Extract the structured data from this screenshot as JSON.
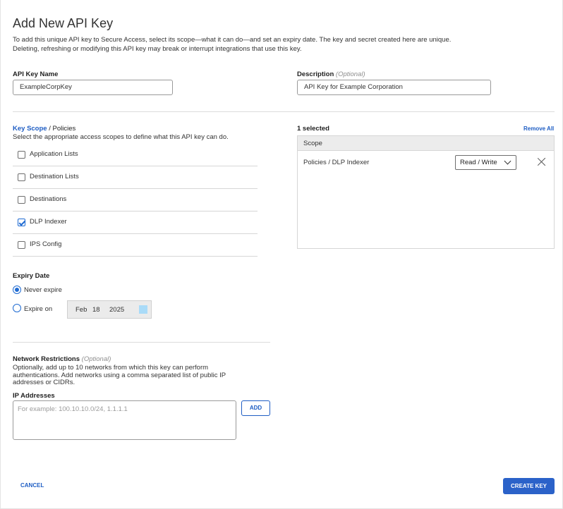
{
  "dialog": {
    "title": "Add New API Key",
    "description_line1": "To add this unique API key to Secure Access, select its scope—what it can do—and set an expiry date. The key and secret created here are unique.",
    "description_line2": "Deleting, refreshing or modifying this API key may break or interrupt integrations that use this key."
  },
  "api_key_name": {
    "label": "API Key Name",
    "value": "ExampleCorpKey"
  },
  "description_field": {
    "label": "Description",
    "optional": "(Optional)",
    "value": "API Key for Example Corporation"
  },
  "key_scope": {
    "link": "Key Scope",
    "separator_path": "/ Policies",
    "help": "Select the appropriate access scopes to define what this API key can do.",
    "items": [
      {
        "label": "Application Lists",
        "checked": false
      },
      {
        "label": "Destination Lists",
        "checked": false
      },
      {
        "label": "Destinations",
        "checked": false
      },
      {
        "label": "DLP Indexer",
        "checked": true
      },
      {
        "label": "IPS Config",
        "checked": false
      }
    ]
  },
  "selected_panel": {
    "count_label": "1 selected",
    "remove_all": "Remove All",
    "column_header": "Scope",
    "rows": [
      {
        "scope": "Policies / DLP Indexer",
        "permission": "Read / Write"
      }
    ]
  },
  "expiry": {
    "label": "Expiry Date",
    "never_label": "Never expire",
    "expire_on_label": "Expire on",
    "selected": "never",
    "date": {
      "month": "Feb",
      "day": "18",
      "year": "2025"
    }
  },
  "network": {
    "label": "Network Restrictions",
    "optional": "(Optional)",
    "help_line1": "Optionally, add up to 10 networks from which this key can perform",
    "help_line2": "authentications. Add networks using a comma separated list of public IP",
    "help_line3": "addresses or CIDRs.",
    "ip_label": "IP Addresses",
    "ip_placeholder": "For example: 100.10.10.0/24, 1.1.1.1",
    "add_button": "ADD"
  },
  "footer": {
    "cancel": "CANCEL",
    "create": "CREATE KEY"
  },
  "colors": {
    "accent": "#2b62c9",
    "link": "#1f5ec4",
    "calendar_swatch": "#a9dbf8"
  }
}
